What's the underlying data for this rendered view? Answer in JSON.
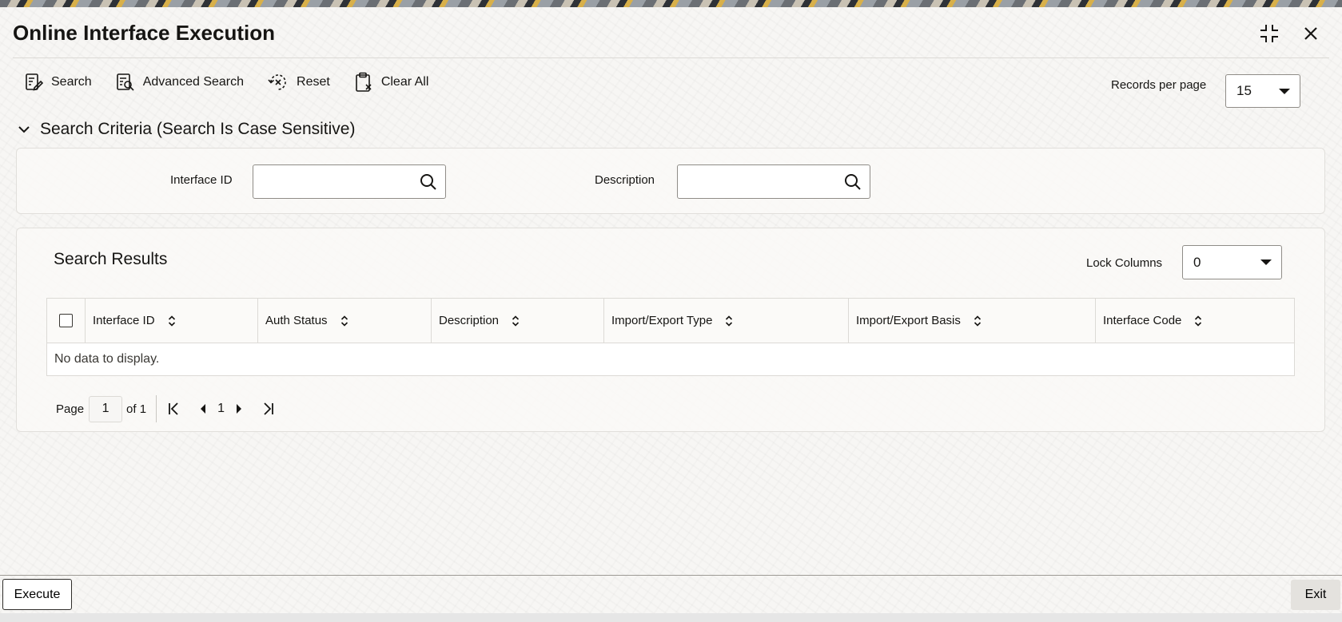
{
  "window": {
    "title": "Online Interface Execution",
    "icons": {
      "maximize": "collapse-corners-icon",
      "close": "close-icon"
    }
  },
  "toolbar": {
    "search_label": "Search",
    "advanced_search_label": "Advanced Search",
    "reset_label": "Reset",
    "clear_all_label": "Clear All",
    "records_per_page_label": "Records per page",
    "records_per_page_value": "15"
  },
  "search_criteria": {
    "header": "Search Criteria (Search Is Case Sensitive)",
    "fields": [
      {
        "label": "Interface ID",
        "value": ""
      },
      {
        "label": "Description",
        "value": ""
      }
    ]
  },
  "results": {
    "title": "Search Results",
    "lock_columns_label": "Lock Columns",
    "lock_columns_value": "0",
    "columns": [
      "Interface ID",
      "Auth Status",
      "Description",
      "Import/Export Type",
      "Import/Export Basis",
      "Interface Code"
    ],
    "empty_message": "No data to display.",
    "pagination": {
      "page_label": "Page",
      "current_page": "1",
      "of_label": "of 1",
      "page_number": "1"
    }
  },
  "footer": {
    "execute_label": "Execute",
    "exit_label": "Exit"
  },
  "colors": {
    "text": "#161513",
    "background": "#f7f6f4",
    "border": "#dcdad6",
    "input_border": "#8f8c87"
  }
}
